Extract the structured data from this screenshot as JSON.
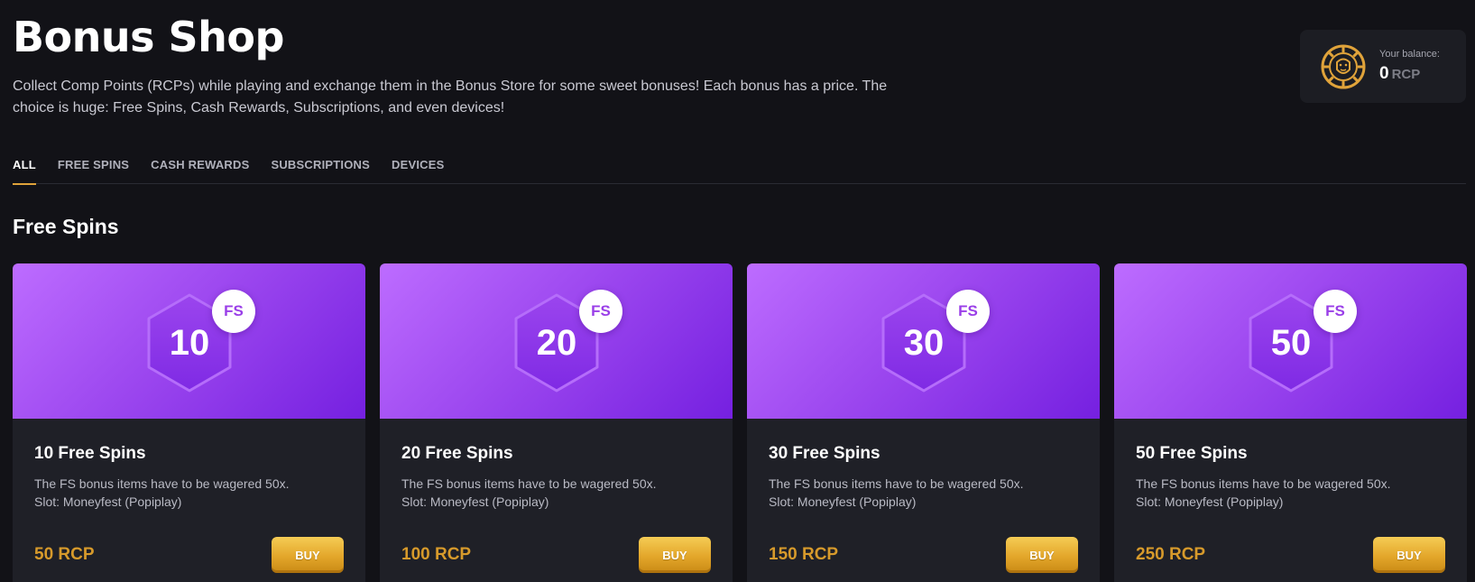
{
  "header": {
    "title": "Bonus Shop",
    "subtitle": "Collect Comp Points (RCPs) while playing and exchange them in the Bonus Store for some sweet bonuses! Each bonus has a price. The choice is huge: Free Spins, Cash Rewards, Subscriptions, and even devices!"
  },
  "balance": {
    "label": "Your balance:",
    "value": "0",
    "unit": "RCP",
    "icon": "lion-coin-icon"
  },
  "tabs": [
    {
      "label": "ALL",
      "active": true
    },
    {
      "label": "FREE SPINS",
      "active": false
    },
    {
      "label": "CASH REWARDS",
      "active": false
    },
    {
      "label": "SUBSCRIPTIONS",
      "active": false
    },
    {
      "label": "DEVICES",
      "active": false
    }
  ],
  "section": {
    "title": "Free Spins"
  },
  "cards": [
    {
      "number": "10",
      "badge": "FS",
      "title": "10 Free Spins",
      "desc1": "The FS bonus items have to be wagered 50x.",
      "desc2": "Slot: Moneyfest (Popiplay)",
      "price": "50 RCP",
      "buy_label": "BUY"
    },
    {
      "number": "20",
      "badge": "FS",
      "title": "20 Free Spins",
      "desc1": "The FS bonus items have to be wagered 50x.",
      "desc2": "Slot: Moneyfest (Popiplay)",
      "price": "100 RCP",
      "buy_label": "BUY"
    },
    {
      "number": "30",
      "badge": "FS",
      "title": "30 Free Spins",
      "desc1": "The FS bonus items have to be wagered 50x.",
      "desc2": "Slot: Moneyfest (Popiplay)",
      "price": "150 RCP",
      "buy_label": "BUY"
    },
    {
      "number": "50",
      "badge": "FS",
      "title": "50 Free Spins",
      "desc1": "The FS bonus items have to be wagered 50x.",
      "desc2": "Slot: Moneyfest (Popiplay)",
      "price": "250 RCP",
      "buy_label": "BUY"
    }
  ],
  "colors": {
    "background": "#121217",
    "accent": "#e0a33a",
    "price": "#d79a2b",
    "banner_start": "#bd6cff",
    "banner_end": "#7520e0"
  }
}
